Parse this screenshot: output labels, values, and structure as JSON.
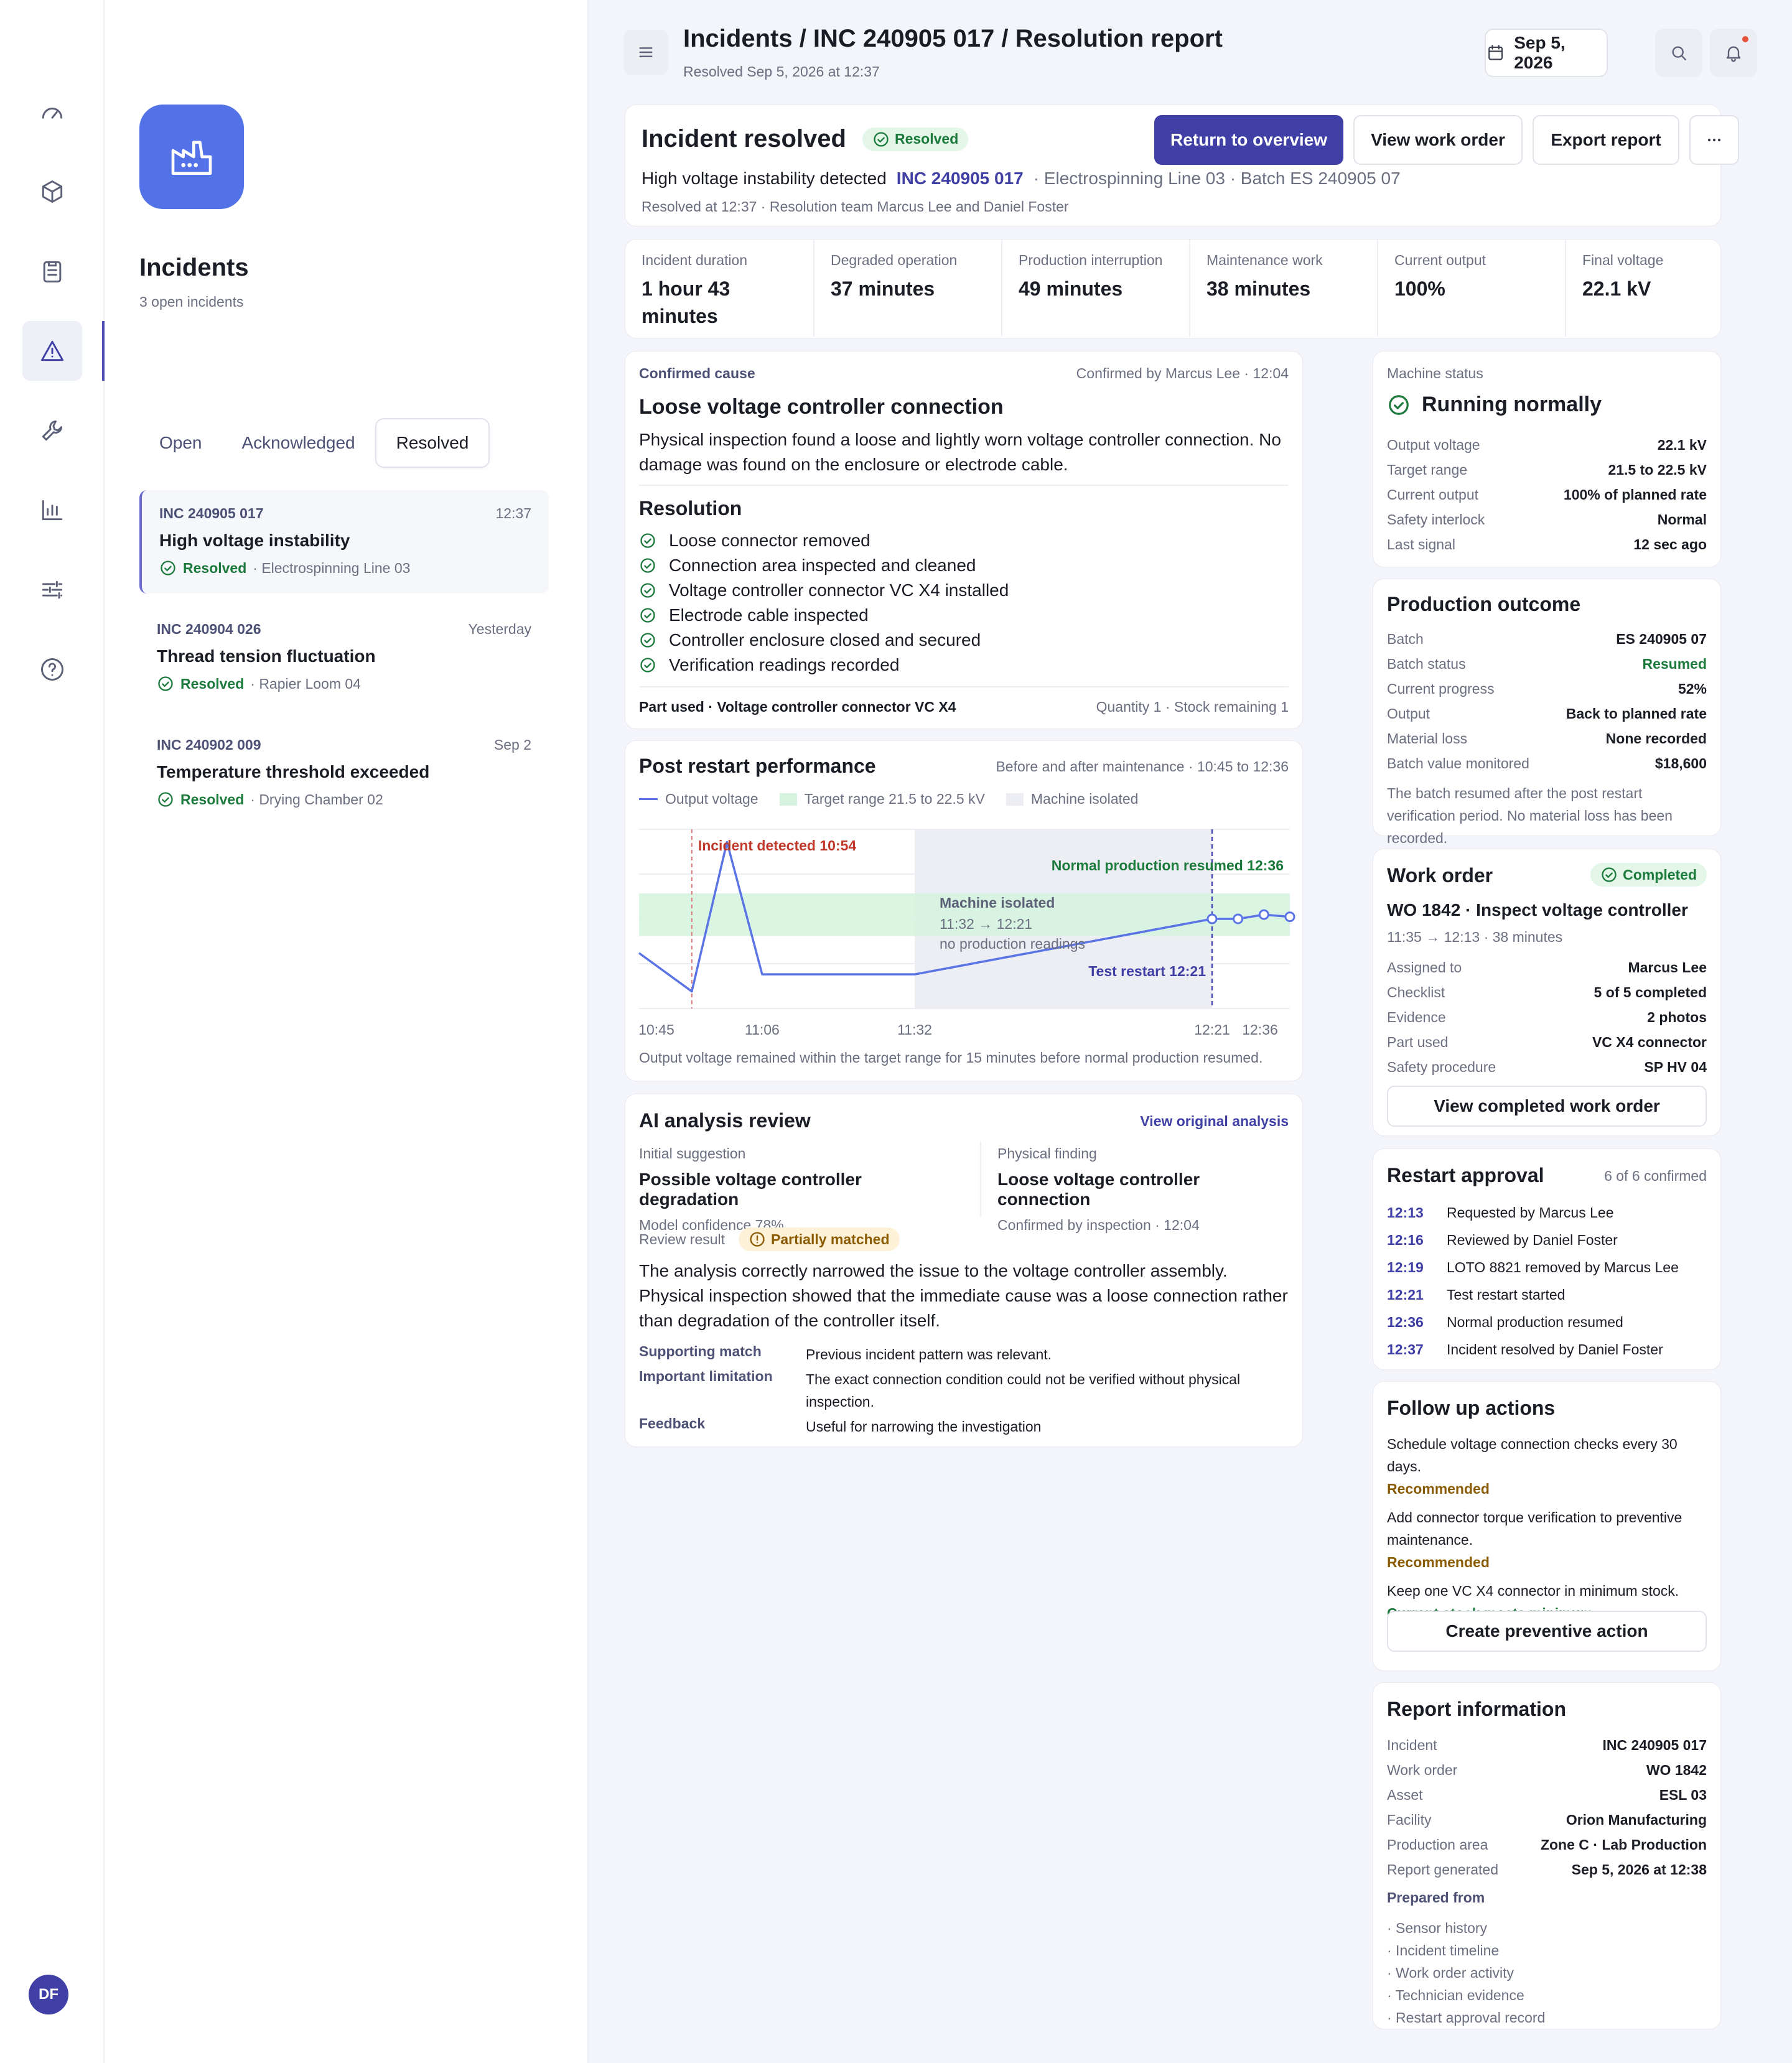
{
  "user": {
    "initials": "DF"
  },
  "sidebar": {
    "title": "Incidents",
    "subtitle": "3 open incidents",
    "tabs": [
      "Open",
      "Acknowledged",
      "Resolved"
    ],
    "incidents": [
      {
        "id": "INC 240905 017",
        "time": "12:37",
        "name": "High voltage instability",
        "status": "Resolved",
        "location": "· Electrospinning Line 03"
      },
      {
        "id": "INC 240904 026",
        "time": "Yesterday",
        "name": "Thread tension fluctuation",
        "status": "Resolved",
        "location": "· Rapier Loom 04"
      },
      {
        "id": "INC 240902 009",
        "time": "Sep 2",
        "name": "Temperature threshold exceeded",
        "status": "Resolved",
        "location": "· Drying Chamber 02"
      }
    ]
  },
  "header": {
    "breadcrumb": "Incidents / INC 240905 017 / Resolution report",
    "subtitle": "Resolved Sep 5, 2026 at 12:37",
    "date": "Sep 5, 2026"
  },
  "summary": {
    "title": "Incident resolved",
    "badge": "Resolved",
    "return_label": "Return to overview",
    "work_order_label": "View work order",
    "export_label": "Export report",
    "issue": "High voltage instability detected",
    "incident_id": "INC 240905 017",
    "location": "· Electrospinning Line 03 · Batch ES 240905 07",
    "team": "Resolved at 12:37 · Resolution team Marcus Lee and Daniel Foster"
  },
  "kpis": [
    {
      "label": "Incident duration",
      "value": "1 hour 43 minutes"
    },
    {
      "label": "Degraded operation",
      "value": "37 minutes"
    },
    {
      "label": "Production interruption",
      "value": "49 minutes"
    },
    {
      "label": "Maintenance work",
      "value": "38 minutes"
    },
    {
      "label": "Current output",
      "value": "100%"
    },
    {
      "label": "Final voltage",
      "value": "22.1 kV"
    }
  ],
  "cause": {
    "label": "Confirmed cause",
    "confirmed": "Confirmed by Marcus Lee · 12:04",
    "title": "Loose voltage controller connection",
    "desc": "Physical inspection found a loose and lightly worn voltage controller connection. No damage was found on the enclosure or electrode cable.",
    "resolution_title": "Resolution",
    "steps": [
      "Loose connector removed",
      "Connection area inspected and cleaned",
      "Voltage controller connector VC X4 installed",
      "Electrode cable inspected",
      "Controller enclosure closed and secured",
      "Verification readings recorded"
    ],
    "part": "Part used · Voltage controller connector VC X4",
    "qty": "Quantity 1 · Stock remaining 1"
  },
  "perf": {
    "title": "Post restart performance",
    "range": "Before and after maintenance · 10:45 to 12:36",
    "note": "Output voltage remained within the target range for 15 minutes before normal production resumed."
  },
  "chart_data": {
    "type": "line",
    "series": [
      {
        "name": "Output voltage",
        "x": [
          "10:45",
          "10:54",
          "11:00",
          "11:06",
          "11:32",
          "12:21",
          "12:26",
          "12:31",
          "12:36"
        ],
        "y": [
          21.1,
          20.2,
          23.7,
          20.6,
          20.6,
          21.9,
          21.9,
          22.0,
          21.95
        ]
      }
    ],
    "legend": [
      "Output voltage",
      "Target range 21.5 to 22.5 kV",
      "Machine isolated"
    ],
    "target_range": [
      21.5,
      22.5
    ],
    "isolated_window": [
      "11:32",
      "12:21"
    ],
    "x_ticks": [
      "10:45",
      "11:06",
      "11:32",
      "12:21",
      "12:36"
    ],
    "annotations": {
      "incident": "Incident detected 10:54",
      "normal": "Normal production resumed 12:36",
      "isolated_title": "Machine isolated",
      "isolated_time": "11:32 → 12:21",
      "isolated_note": "no production readings",
      "restart": "Test restart 12:21"
    },
    "ylim": [
      19.8,
      24.0
    ],
    "grid": true
  },
  "ai": {
    "title": "AI analysis review",
    "link": "View original analysis",
    "initial_label": "Initial suggestion",
    "initial_value": "Possible voltage controller degradation",
    "initial_meta": "Model confidence 78%",
    "finding_label": "Physical finding",
    "finding_value": "Loose voltage controller connection",
    "finding_meta": "Confirmed by inspection · 12:04",
    "result_label": "Review result",
    "result_badge": "Partially matched",
    "text": "The analysis correctly narrowed the issue to the voltage controller assembly. Physical inspection showed that the immediate cause was a loose connection rather than degradation of the controller itself.",
    "rows": [
      {
        "k": "Supporting match",
        "v": "Previous incident pattern was relevant."
      },
      {
        "k": "Important limitation",
        "v": "The exact connection condition could not be verified without physical inspection."
      },
      {
        "k": "Feedback",
        "v": "Useful for narrowing the investigation"
      }
    ]
  },
  "machine": {
    "label": "Machine status",
    "status": "Running normally",
    "rows": [
      {
        "k": "Output voltage",
        "v": "22.1 kV"
      },
      {
        "k": "Target range",
        "v": "21.5 to 22.5 kV"
      },
      {
        "k": "Current output",
        "v": "100% of planned rate"
      },
      {
        "k": "Safety interlock",
        "v": "Normal"
      },
      {
        "k": "Last signal",
        "v": "12 sec ago"
      }
    ]
  },
  "production": {
    "title": "Production outcome",
    "rows": [
      {
        "k": "Batch",
        "v": "ES 240905 07"
      },
      {
        "k": "Batch status",
        "v": "Resumed"
      },
      {
        "k": "Current progress",
        "v": "52%"
      },
      {
        "k": "Output",
        "v": "Back to planned rate"
      },
      {
        "k": "Material loss",
        "v": "None recorded"
      },
      {
        "k": "Batch value monitored",
        "v": "$18,600"
      }
    ],
    "note": "The batch resumed after the post restart verification period. No material loss has been recorded."
  },
  "workorder": {
    "title": "Work order",
    "badge": "Completed",
    "name": "WO 1842 · Inspect voltage controller",
    "time": "11:35 → 12:13 · 38 minutes",
    "rows": [
      {
        "k": "Assigned to",
        "v": "Marcus Lee"
      },
      {
        "k": "Checklist",
        "v": "5 of 5 completed"
      },
      {
        "k": "Evidence",
        "v": "2 photos"
      },
      {
        "k": "Part used",
        "v": "VC X4 connector"
      },
      {
        "k": "Safety procedure",
        "v": "SP HV 04"
      }
    ],
    "button": "View completed work order"
  },
  "approval": {
    "title": "Restart approval",
    "count": "6 of 6 confirmed",
    "rows": [
      {
        "t": "12:13",
        "v": "Requested by Marcus Lee"
      },
      {
        "t": "12:16",
        "v": "Reviewed by Daniel Foster"
      },
      {
        "t": "12:19",
        "v": "LOTO 8821 removed by Marcus Lee"
      },
      {
        "t": "12:21",
        "v": "Test restart started"
      },
      {
        "t": "12:36",
        "v": "Normal production resumed"
      },
      {
        "t": "12:37",
        "v": "Incident resolved by Daniel Foster"
      }
    ]
  },
  "followup": {
    "title": "Follow up actions",
    "items": [
      {
        "text": "Schedule voltage connection checks every 30 days.",
        "tag": "Recommended"
      },
      {
        "text": "Add connector torque verification to preventive maintenance.",
        "tag": "Recommended"
      },
      {
        "text": "Keep one VC X4 connector in minimum stock.",
        "tag": "Current stock meets minimum"
      }
    ],
    "button": "Create preventive action"
  },
  "report": {
    "title": "Report information",
    "rows": [
      {
        "k": "Incident",
        "v": "INC 240905 017"
      },
      {
        "k": "Work order",
        "v": "WO 1842"
      },
      {
        "k": "Asset",
        "v": "ESL 03"
      },
      {
        "k": "Facility",
        "v": "Orion Manufacturing"
      },
      {
        "k": "Production area",
        "v": "Zone C · Lab Production"
      },
      {
        "k": "Report generated",
        "v": "Sep 5, 2026 at 12:38"
      }
    ],
    "prepared_label": "Prepared from",
    "sources": [
      "· Sensor history",
      "· Incident timeline",
      "· Work order activity",
      "· Technician evidence",
      "· Restart approval record"
    ]
  },
  "colors": {
    "accent": "#3f3fa6",
    "success": "#1b7a3c",
    "warning": "#8a5a00",
    "alert": "#c0392b",
    "line": "#5a74e6"
  }
}
